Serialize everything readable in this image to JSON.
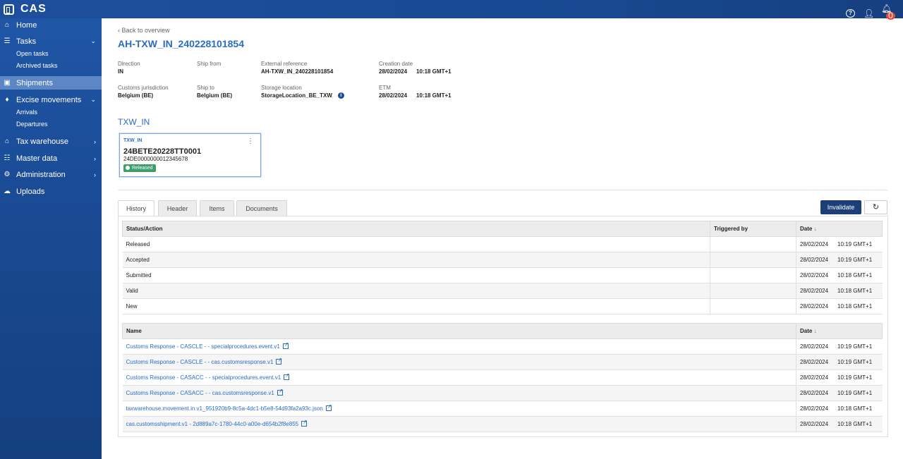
{
  "app": {
    "name": "CAS",
    "notifications": "0"
  },
  "sidebar": {
    "items": [
      {
        "label": "Home",
        "icon": "home-icon"
      },
      {
        "label": "Tasks",
        "icon": "tasks-icon",
        "sub": [
          "Open tasks",
          "Archived tasks"
        ]
      },
      {
        "label": "Shipments",
        "icon": "shipments-icon"
      },
      {
        "label": "Excise movements",
        "icon": "excise-icon",
        "sub": [
          "Arrivals",
          "Departures"
        ]
      },
      {
        "label": "Tax warehouse",
        "icon": "warehouse-icon"
      },
      {
        "label": "Master data",
        "icon": "master-data-icon"
      },
      {
        "label": "Administration",
        "icon": "administration-icon"
      },
      {
        "label": "Uploads",
        "icon": "upload-icon"
      }
    ]
  },
  "page": {
    "back": "Back to overview",
    "title": "AH-TXW_IN_240228101854",
    "fields": {
      "direction": {
        "label": "Direction",
        "value": "IN"
      },
      "ship_from": {
        "label": "Ship from",
        "value": ""
      },
      "external_reference": {
        "label": "External reference",
        "value": "AH-TXW_IN_240228101854"
      },
      "creation_date": {
        "label": "Creation date",
        "value": "28/02/2024",
        "time": "10:18 GMT+1"
      },
      "customs_jurisdiction": {
        "label": "Customs jurisdiction",
        "value": "Belgium (BE)"
      },
      "ship_to": {
        "label": "Ship to",
        "value": "Belgium (BE)"
      },
      "storage_location": {
        "label": "Storage location",
        "value": "StorageLocation_BE_TXW"
      },
      "etm": {
        "label": "ETM",
        "value": "28/02/2024",
        "time": "10:18 GMT+1"
      }
    },
    "section_title": "TXW_IN",
    "card": {
      "tag": "TXW_IN",
      "id": "24BETE20228TT0001",
      "sub": "24DE0000000012345678",
      "status": "Released"
    }
  },
  "tabs": [
    "History",
    "Header",
    "Items",
    "Documents"
  ],
  "actions": {
    "invalidate": "Invalidate"
  },
  "history": {
    "columns": [
      "Status/Action",
      "Triggered by",
      "Date"
    ],
    "rows": [
      {
        "status": "Released",
        "by": "",
        "date": "28/02/2024",
        "time": "10:19 GMT+1"
      },
      {
        "status": "Accepted",
        "by": "",
        "date": "28/02/2024",
        "time": "10:19 GMT+1"
      },
      {
        "status": "Submitted",
        "by": "",
        "date": "28/02/2024",
        "time": "10:18 GMT+1"
      },
      {
        "status": "Valid",
        "by": "",
        "date": "28/02/2024",
        "time": "10:18 GMT+1"
      },
      {
        "status": "New",
        "by": "",
        "date": "28/02/2024",
        "time": "10:18 GMT+1"
      }
    ]
  },
  "documents": {
    "columns": [
      "Name",
      "Date"
    ],
    "rows": [
      {
        "name": "Customs Response - CASCLE -  - specialprocedures.event.v1",
        "date": "28/02/2024",
        "time": "10:19 GMT+1"
      },
      {
        "name": "Customs Response - CASCLE -  - cas.customsresponse.v1",
        "date": "28/02/2024",
        "time": "10:19 GMT+1"
      },
      {
        "name": "Customs Response - CASACC -  - specialprocedures.event.v1",
        "date": "28/02/2024",
        "time": "10:19 GMT+1"
      },
      {
        "name": "Customs Response - CASACC -  - cas.customsresponse.v1",
        "date": "28/02/2024",
        "time": "10:19 GMT+1"
      },
      {
        "name": "taxwarehouse.movement.in.v1_951920b9-8c5a-4dc1-b5e8-54d93fa2a93c.json",
        "date": "28/02/2024",
        "time": "10:18 GMT+1"
      },
      {
        "name": "cas.customsshipment.v1 - 2d889a7c-1780-44c0-a00e-d654b2f8e855",
        "date": "28/02/2024",
        "time": "10:18 GMT+1"
      }
    ]
  }
}
